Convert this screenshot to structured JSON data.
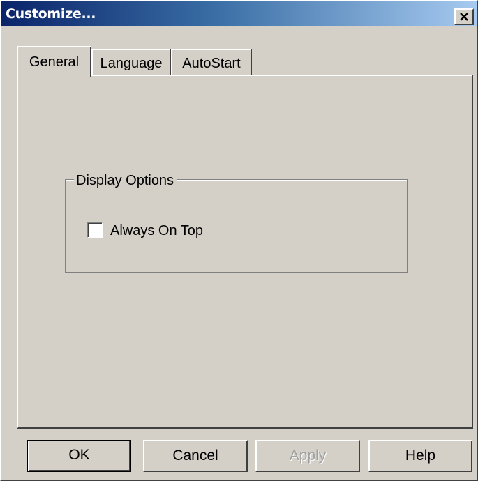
{
  "window": {
    "title": "Customize...",
    "close_label": "Close"
  },
  "tabs": [
    {
      "label": "General",
      "selected": true
    },
    {
      "label": "Language",
      "selected": false
    },
    {
      "label": "AutoStart",
      "selected": false
    }
  ],
  "general": {
    "group_label": "Display Options",
    "always_on_top": {
      "label": "Always On Top",
      "checked": false
    }
  },
  "buttons": {
    "ok": "OK",
    "cancel": "Cancel",
    "apply": "Apply",
    "help": "Help"
  },
  "colors": {
    "title_gradient_start": "#0a246a",
    "title_gradient_end": "#a6caf0",
    "face": "#d4d0c8",
    "disabled_text": "#a0a0a0"
  }
}
